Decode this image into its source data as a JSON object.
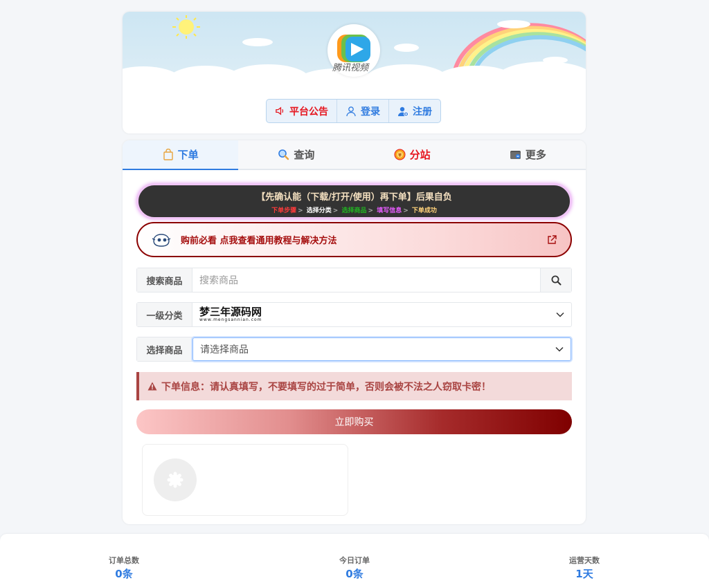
{
  "header": {
    "logo_text": "腾讯视频",
    "buttons": [
      {
        "label": "平台公告",
        "icon": "speaker-icon"
      },
      {
        "label": "登录",
        "icon": "user-icon"
      },
      {
        "label": "注册",
        "icon": "add-user-icon"
      }
    ]
  },
  "tabs": [
    {
      "label": "下单",
      "icon": "shopping-bag-icon"
    },
    {
      "label": "查询",
      "icon": "magnifier-icon"
    },
    {
      "label": "分站",
      "icon": "coin-icon"
    },
    {
      "label": "更多",
      "icon": "wallet-icon"
    }
  ],
  "notice": {
    "title": "【先确认能（下载/打开/使用）再下单】后果自负",
    "steps": [
      "下单步骤",
      "选择分类",
      "选择商品",
      "填写信息",
      "下单成功"
    ],
    "step_colors": [
      "#ff3b3b",
      "#ffffff",
      "#22b422",
      "#e75cff",
      "#ffd27a"
    ],
    "separator": ">"
  },
  "guide": {
    "text": "购前必看 点我查看通用教程与解决方法"
  },
  "form": {
    "search_label": "搜索商品",
    "search_placeholder": "搜索商品",
    "category_label": "一级分类",
    "category_value_main": "梦三年源码网",
    "category_value_sub": "www.mengsannian.com",
    "product_label": "选择商品",
    "product_value": "请选择商品"
  },
  "warning": {
    "text": "下单信息：请认真填写，不要填写的过于简单，否则会被不法之人窃取卡密！"
  },
  "buy_button": "立即购买",
  "stats": [
    {
      "label": "订单总数",
      "value": "0条"
    },
    {
      "label": "今日订单",
      "value": "0条"
    },
    {
      "label": "运营天数",
      "value": "1天"
    }
  ],
  "colors": {
    "accent_blue": "#2f7be0",
    "accent_red": "#e6161f",
    "dark_red": "#8b0000"
  }
}
